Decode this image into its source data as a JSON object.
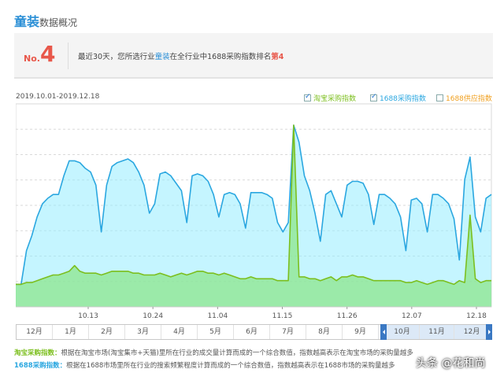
{
  "header": {
    "title_accent": "童装",
    "title_rest": "数据概况"
  },
  "rank": {
    "no_label": "No.",
    "number": "4",
    "text_before": "最近30天，您所选行业",
    "industry": "童装",
    "text_middle": "在全行业中1688采购指数排名",
    "rank_text": "第4"
  },
  "date_range": "2019.10.01-2019.12.18",
  "legend": {
    "items": [
      {
        "label": "淘宝采购指数",
        "checked": true,
        "color": "#7cbf1e"
      },
      {
        "label": "1688采购指数",
        "checked": true,
        "color": "#2ba7e0"
      },
      {
        "label": "1688供应指数",
        "checked": false,
        "color": "#f0a020"
      }
    ]
  },
  "chart_data": {
    "type": "area",
    "x_tick_labels": [
      "10.13",
      "10.24",
      "11.04",
      "11.15",
      "11.26",
      "12.07",
      "12.18"
    ],
    "grid": true,
    "series": [
      {
        "name": "1688采购指数",
        "color": "#2ba7e0",
        "values": [
          12,
          12,
          30,
          38,
          48,
          55,
          58,
          60,
          60,
          70,
          78,
          78,
          77,
          74,
          72,
          65,
          40,
          65,
          75,
          77,
          78,
          79,
          77,
          72,
          65,
          50,
          55,
          71,
          72,
          70,
          66,
          62,
          45,
          70,
          71,
          70,
          67,
          60,
          48,
          60,
          61,
          60,
          55,
          42,
          61,
          61,
          61,
          60,
          58,
          45,
          40,
          45,
          97,
          88,
          70,
          62,
          50,
          35,
          60,
          62,
          55,
          48,
          65,
          67,
          67,
          66,
          60,
          44,
          60,
          60,
          58,
          55,
          48,
          30,
          57,
          58,
          55,
          40,
          60,
          60,
          58,
          55,
          47,
          25,
          68,
          80,
          48,
          40,
          58,
          60
        ]
      },
      {
        "name": "淘宝采购指数",
        "color": "#7cbf1e",
        "values": [
          12,
          12,
          13,
          13,
          14,
          15,
          16,
          17,
          17,
          18,
          19,
          22,
          19,
          18,
          18,
          18,
          17,
          18,
          19,
          19,
          19,
          19,
          18,
          18,
          17,
          17,
          17,
          18,
          17,
          16,
          17,
          18,
          17,
          18,
          19,
          19,
          18,
          18,
          17,
          18,
          17,
          16,
          15,
          15,
          16,
          15,
          15,
          15,
          15,
          14,
          14,
          14,
          97,
          16,
          16,
          15,
          15,
          14,
          15,
          16,
          14,
          16,
          16,
          17,
          16,
          16,
          15,
          14,
          14,
          14,
          14,
          14,
          14,
          13,
          13,
          14,
          13,
          12,
          13,
          14,
          14,
          13,
          12,
          14,
          13,
          49,
          15,
          13,
          14,
          14
        ]
      }
    ]
  },
  "slider": {
    "months": [
      "12月",
      "1月",
      "2月",
      "3月",
      "4月",
      "5月",
      "6月",
      "7月",
      "8月",
      "9月",
      "10月",
      "11月",
      "12月"
    ]
  },
  "notes": [
    {
      "label": "淘宝采购指数：",
      "text": "根据在淘宝市场(淘宝集市+天猫)里所在行业的成交量计算而成的一个综合数值，指数越高表示在淘宝市场的采购量越多",
      "color": "#7cbf1e"
    },
    {
      "label": "1688采购指数：",
      "text": "根据在1688市场里所在行业的搜索频繁程度计算而成的一个综合数值，指数越高表示在1688市场的采购量越多",
      "color": "#2ba7e0"
    }
  ],
  "watermark": "头条 @花和尚"
}
